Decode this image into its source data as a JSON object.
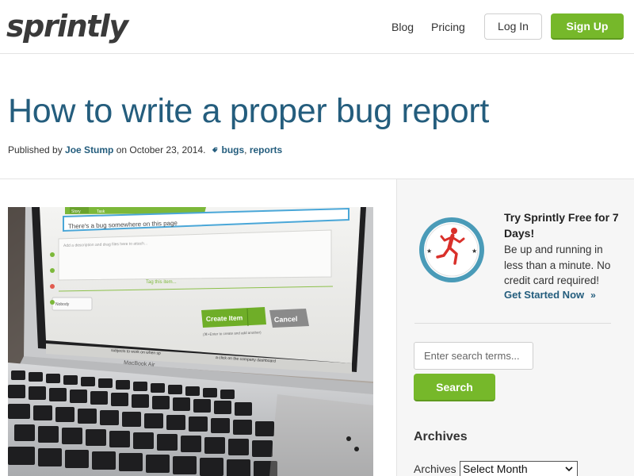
{
  "header": {
    "logo": "sprintly",
    "nav": {
      "blog": "Blog",
      "pricing": "Pricing"
    },
    "login_label": "Log In",
    "signup_label": "Sign Up"
  },
  "post": {
    "title": "How to write a proper bug report",
    "byline": {
      "published_by": "Published by ",
      "author": "Joe Stump",
      "on_date": " on October 23, 2014.",
      "tags": [
        "bugs",
        "reports"
      ],
      "tag_separator": ", "
    },
    "image": {
      "screen_text": {
        "tab_story": "Story",
        "tab_task": "Task",
        "title_field": "There's a bug somewhere on this page",
        "description_placeholder": "Add a description and drag files here to attach...",
        "tag_placeholder": "Tag this item...",
        "assignee": "Nobody",
        "create_button": "Create Item",
        "cancel_button": "Cancel",
        "hint": "(⌘+Enter to create and add another)",
        "row_left": "subjects to work on when sp",
        "row_right": "a click on the company dashboard",
        "laptop_brand": "MacBook Air"
      }
    }
  },
  "sidebar": {
    "promo": {
      "title": "Try Sprintly Free for 7 Days!",
      "text": "Be up and running in less than a minute. No credit card required!",
      "link_label": "Get Started Now",
      "link_arrow": "»",
      "badge_icon": "runner-icon"
    },
    "search": {
      "placeholder": "Enter search terms...",
      "button_label": "Search"
    },
    "archives": {
      "heading": "Archives",
      "label": "Archives",
      "selected": "Select Month"
    }
  },
  "colors": {
    "brand_green": "#76b82a",
    "title_blue": "#245d7d",
    "badge_ring": "#4a9bb8",
    "runner_red": "#d9302a"
  }
}
